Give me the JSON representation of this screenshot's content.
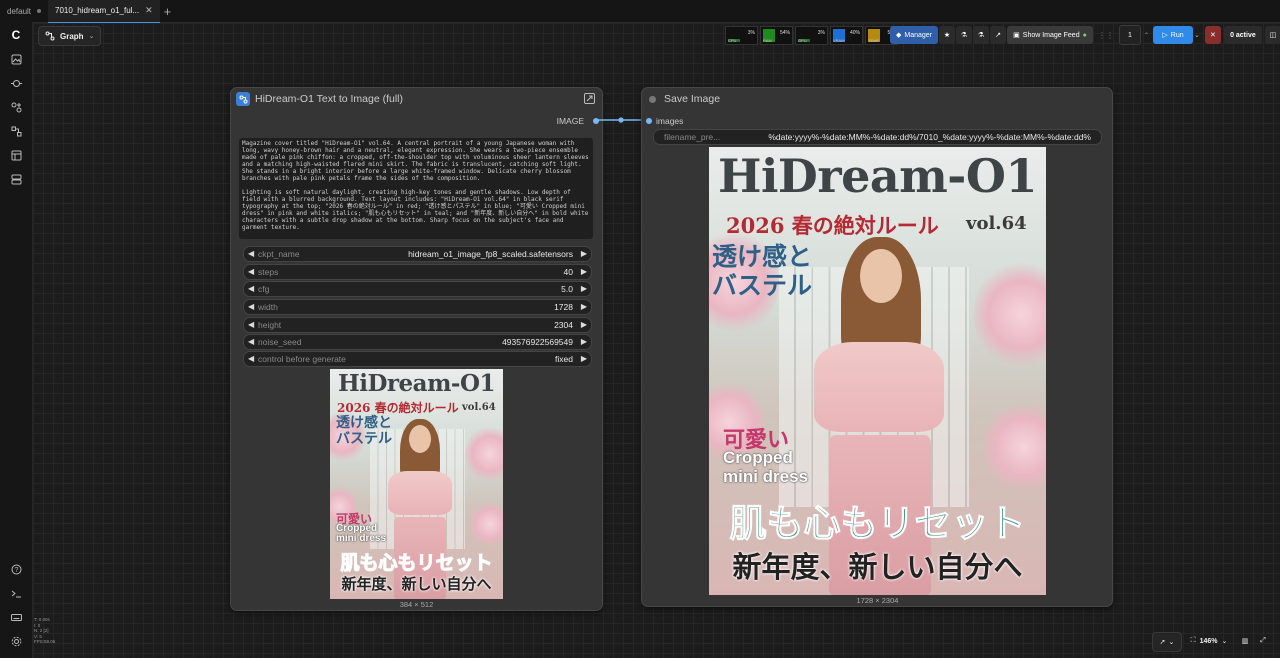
{
  "tabs": [
    {
      "label": "default",
      "active": false
    },
    {
      "label": "7010_hidream_o1_ful...",
      "active": true
    }
  ],
  "toolbar": {
    "graph_label": "Graph",
    "meters": [
      {
        "label": "CPU",
        "value": "3%",
        "color": "#2d6a2d"
      },
      {
        "label": "RAM",
        "value": "54%",
        "color": "#1f8a1f"
      },
      {
        "label": "GPU",
        "value": "3%",
        "color": "#2d6a2d"
      },
      {
        "label": "VRAM",
        "value": "40%",
        "color": "#1f6fd0"
      },
      {
        "label": "TEMP",
        "value": "55°",
        "color": "#b58a10"
      }
    ],
    "manager_label": "Manager",
    "image_feed_label": "Show Image Feed",
    "batch_count": "1",
    "run_label": "Run",
    "active_label": "0 active"
  },
  "node_text2img": {
    "title": "HiDream-O1 Text to Image (full)",
    "output_label": "IMAGE",
    "prompt_p1": "Magazine cover titled \"HiDream-O1\" vol.64. A central portrait of a young Japanese woman with long, wavy honey-brown hair and a neutral, elegant expression. She wears a two-piece ensemble made of pale pink chiffon: a cropped, off-the-shoulder top with voluminous sheer lantern sleeves and a matching high-waisted flared mini skirt. The fabric is translucent, catching soft light. She stands in a bright interior before a large white-framed window. Delicate cherry blossom branches with pale pink petals frame the sides of the composition.",
    "prompt_p2": "Lighting is soft natural daylight, creating high-key tones and gentle shadows. Low depth of field with a blurred background. Text layout includes: \"HiDream-O1 vol.64\" in black serif typography at the top; \"2026 春の絶対ルール\" in red; \"透け感とパステル\" in blue; \"可愛い Cropped mini dress\" in pink and white italics; \"肌も心もリセット\" in teal; and \"新年度、新しい自分へ\" in bold white characters with a subtle drop shadow at the bottom. Sharp focus on the subject's face and garment texture.",
    "widgets": [
      {
        "name": "ckpt_name",
        "value": "hidream_o1_image_fp8_scaled.safetensors"
      },
      {
        "name": "steps",
        "value": "40"
      },
      {
        "name": "cfg",
        "value": "5.0"
      },
      {
        "name": "width",
        "value": "1728"
      },
      {
        "name": "height",
        "value": "2304"
      },
      {
        "name": "noise_seed",
        "value": "493576922569549"
      },
      {
        "name": "control before generate",
        "value": "fixed"
      }
    ],
    "preview_dims": "384 × 512"
  },
  "node_save": {
    "title": "Save Image",
    "input_label": "images",
    "filename_label": "filename_pre...",
    "filename_value": "%date:yyyy%-%date:MM%-%date:dd%/7010_%date:yyyy%-%date:MM%-%date:dd%",
    "image_dims": "1728 × 2304"
  },
  "cover": {
    "title": "HiDream-O1",
    "subtitle": "2026 春の絶対ルール",
    "volume": "vol.64",
    "blue_line1": "透け感と",
    "blue_line2": "バステル",
    "pink": "可愛い",
    "white_line1": "Cropped",
    "white_line2": "mini dress",
    "teal": "肌も心もリセット",
    "bottom": "新年度、新しい自分へ"
  },
  "status_lines": [
    "T: 0.00s",
    "I: 0",
    "N: 2 [2]",
    "V: 5",
    "FPS:59.06"
  ],
  "bottom_controls": {
    "zoom": "146%"
  },
  "colors": {
    "accent": "#3a8ee6",
    "link": "#7ab8f5",
    "node_bg": "#353535"
  }
}
